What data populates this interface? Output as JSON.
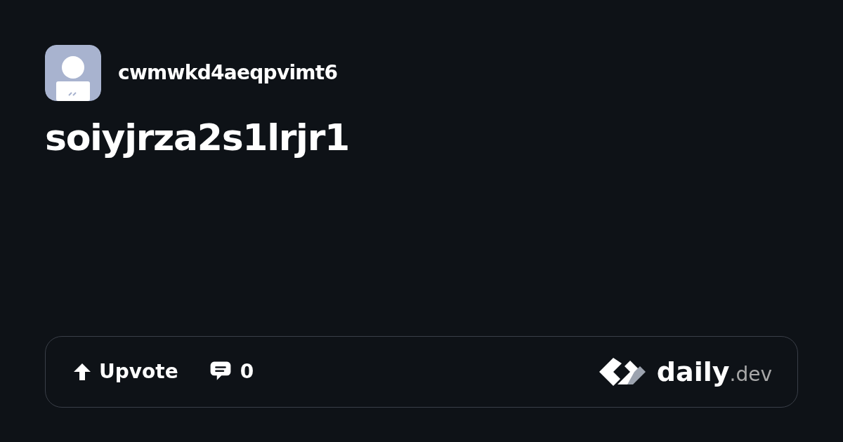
{
  "author": {
    "username": "cwmwkd4aeqpvimt6"
  },
  "post": {
    "title": "soiyjrza2s1lrjr1"
  },
  "actions": {
    "upvote": "Upvote",
    "comments": "0"
  },
  "brand": {
    "name": "daily",
    "suffix": ".dev"
  }
}
